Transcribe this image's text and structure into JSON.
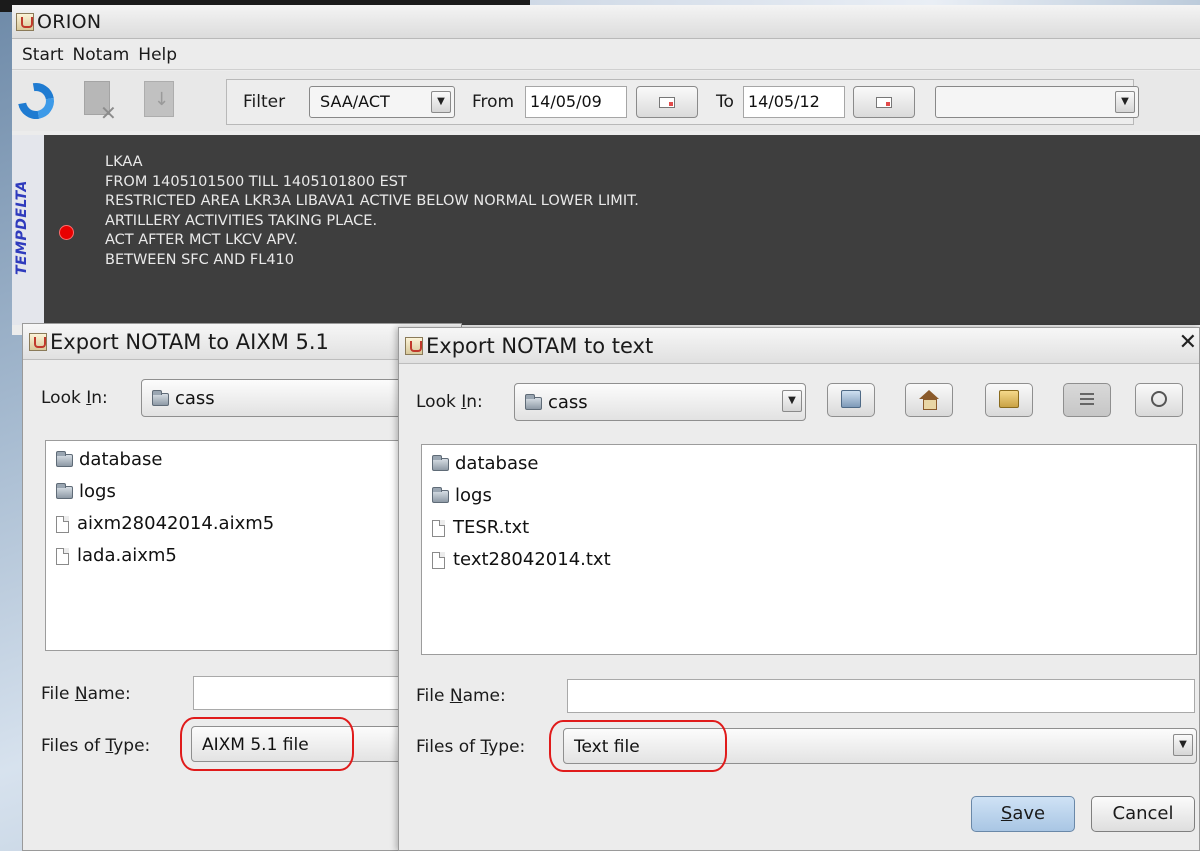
{
  "main_window": {
    "title": "ORION",
    "menu": [
      "Start",
      "Notam",
      "Help"
    ],
    "toolbar": {
      "filter_label": "Filter",
      "filter_value": "SAA/ACT",
      "from_label": "From",
      "from_value": "14/05/09",
      "to_label": "To",
      "to_value": "14/05/12",
      "extra_select_value": ""
    },
    "notam": {
      "side_label": "TEMPDELTA",
      "status_color": "#e80000",
      "lines": [
        "LKAA",
        "FROM 1405101500 TILL 1405101800 EST",
        "RESTRICTED AREA LKR3A LIBAVA1 ACTIVE BELOW NORMAL LOWER LIMIT.",
        "ARTILLERY ACTIVITIES TAKING PLACE.",
        "ACT AFTER MCT LKCV APV.",
        "BETWEEN SFC AND FL410"
      ]
    }
  },
  "dialog_aixm": {
    "title": "Export NOTAM to AIXM 5.1",
    "look_in_label_pre": "Look ",
    "look_in_label_key": "I",
    "look_in_label_post": "n:",
    "look_in_value": "cass",
    "files": [
      {
        "name": "database",
        "type": "folder"
      },
      {
        "name": "logs",
        "type": "folder"
      },
      {
        "name": "aixm28042014.aixm5",
        "type": "file"
      },
      {
        "name": "lada.aixm5",
        "type": "file"
      }
    ],
    "file_name_label_pre": "File ",
    "file_name_label_key": "N",
    "file_name_label_post": "ame:",
    "file_name_value": "",
    "files_of_type_label_pre": "Files of ",
    "files_of_type_label_key": "T",
    "files_of_type_label_post": "ype:",
    "files_of_type_value": "AIXM 5.1 file"
  },
  "dialog_text": {
    "title": "Export NOTAM to text",
    "look_in_label_pre": "Look ",
    "look_in_label_key": "I",
    "look_in_label_post": "n:",
    "look_in_value": "cass",
    "files": [
      {
        "name": "database",
        "type": "folder"
      },
      {
        "name": "logs",
        "type": "folder"
      },
      {
        "name": "TESR.txt",
        "type": "file"
      },
      {
        "name": "text28042014.txt",
        "type": "file"
      }
    ],
    "file_name_label_pre": "File ",
    "file_name_label_key": "N",
    "file_name_label_post": "ame:",
    "file_name_value": "",
    "files_of_type_label_pre": "Files of ",
    "files_of_type_label_key": "T",
    "files_of_type_label_post": "ype:",
    "files_of_type_value": "Text file",
    "save_key": "S",
    "save_rest": "ave",
    "cancel_label": "Cancel"
  },
  "colors": {
    "highlight": "#e01b1b",
    "notam_background": "#3e3e3e",
    "side_label": "#2f3bbd"
  }
}
